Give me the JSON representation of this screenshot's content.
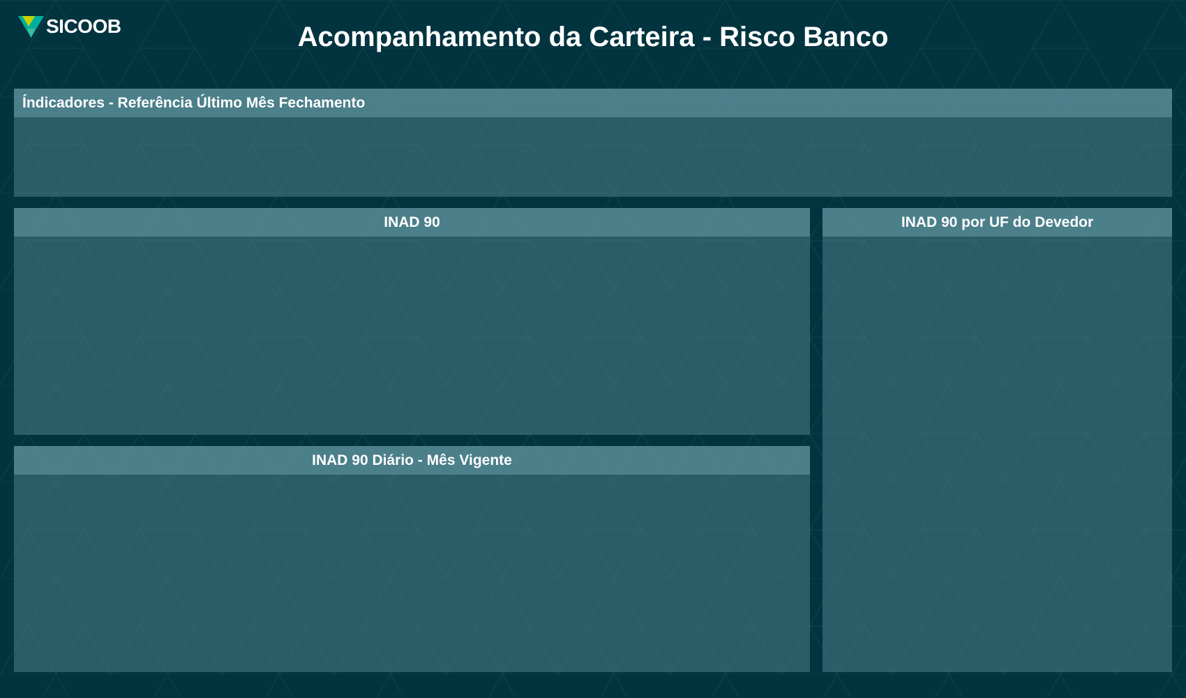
{
  "brand": {
    "name": "SICOOB",
    "icon": "sicoob-logo-icon",
    "colors": {
      "leaf_teal": "#00AE9D",
      "leaf_lime": "#C9D200"
    }
  },
  "header": {
    "title": "Acompanhamento da Carteira - Risco Banco"
  },
  "panels": {
    "indicadores": {
      "title": "Índicadores - Referência Último Mês Fechamento"
    },
    "inad90": {
      "title": "INAD 90"
    },
    "inad90_uf": {
      "title": "INAD 90 por UF do Devedor"
    },
    "inad90_diario": {
      "title": "INAD 90 Diário - Mês Vigente"
    }
  },
  "theme": {
    "background": "#023440",
    "panel_fill": "#2F6370",
    "panel_header_fill": "#4B7D88",
    "text": "#FFFFFF"
  }
}
